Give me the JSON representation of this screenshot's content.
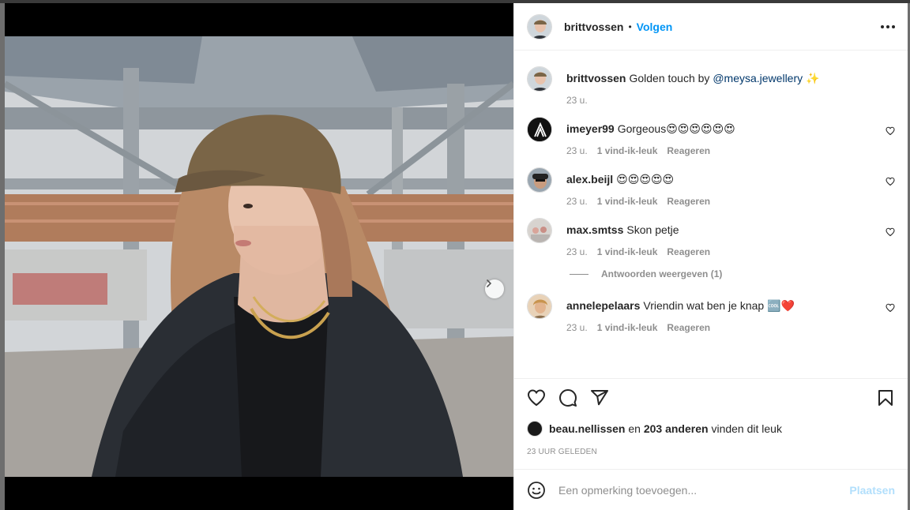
{
  "post": {
    "author": "brittvossen",
    "follow_label": "Volgen",
    "separator": "•",
    "caption_prefix": "Golden touch by ",
    "caption_mention": "@meysa.jewellery",
    "caption_suffix": " ✨",
    "caption_time": "23 u."
  },
  "comments": [
    {
      "user": "imeyer99",
      "text": "Gorgeous😍😍😍😍😍😍",
      "time": "23 u.",
      "likes": "1 vind-ik-leuk",
      "reply": "Reageren"
    },
    {
      "user": "alex.beijl",
      "text": "😍😍😍😍😍",
      "time": "23 u.",
      "likes": "1 vind-ik-leuk",
      "reply": "Reageren"
    },
    {
      "user": "max.smtss",
      "text": "Skon petje",
      "time": "23 u.",
      "likes": "1 vind-ik-leuk",
      "reply": "Reageren",
      "view_replies": "Antwoorden weergeven (1)"
    },
    {
      "user": "annelepelaars",
      "text": "Vriendin wat ben je knap 🆒❤️",
      "time": "23 u.",
      "likes": "1 vind-ik-leuk",
      "reply": "Reageren"
    }
  ],
  "likes": {
    "first_user": "beau.nellissen",
    "connector": " en ",
    "others": "203 anderen",
    "suffix": " vinden dit leuk"
  },
  "posted_ago": "23 UUR GELEDEN",
  "composer": {
    "placeholder": "Een opmerking toevoegen...",
    "post_label": "Plaatsen"
  },
  "carousel": {
    "count": 3,
    "active_index": 0
  },
  "colors": {
    "accent": "#0095f6",
    "post_disabled": "#b2dffc",
    "muted": "#8e8e8e"
  },
  "icons": [
    "heart-icon",
    "comment-icon",
    "share-icon",
    "bookmark-icon",
    "emoji-icon",
    "chevron-right-icon",
    "user-tag-icon",
    "more-icon"
  ]
}
